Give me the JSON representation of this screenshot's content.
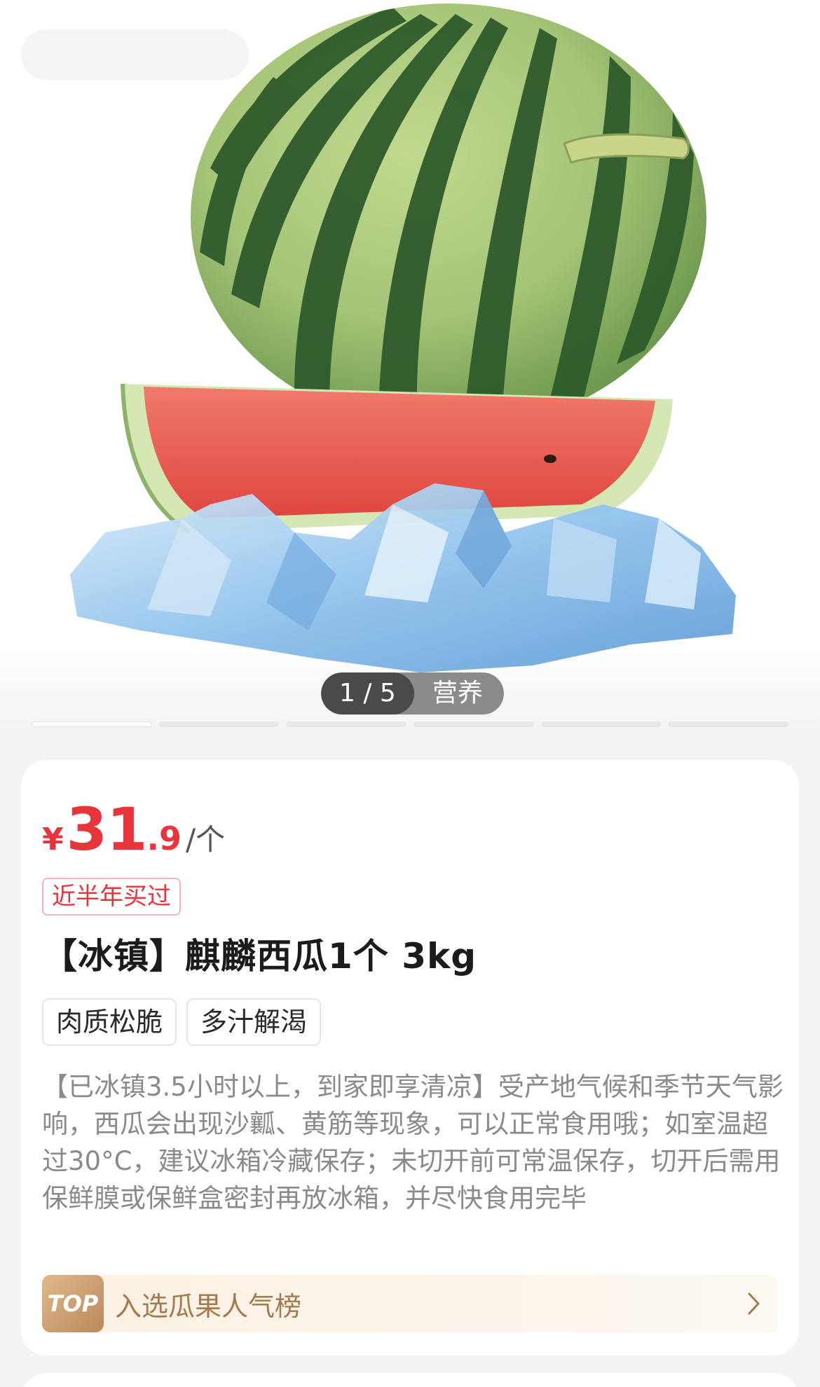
{
  "gallery": {
    "counter": "1 / 5",
    "tag": "营养",
    "total_slides": 6,
    "active_slide": 1
  },
  "product": {
    "price": {
      "currency": "¥",
      "integer": "31",
      "decimal": ".9",
      "unit": "/个"
    },
    "bought_badge": "近半年买过",
    "title": "【冰镇】麒麟西瓜1个 3kg",
    "tags": [
      "肉质松脆",
      "多汁解渴"
    ],
    "description": "【已冰镇3.5小时以上，到家即享清凉】受产地气候和季节天气影响，西瓜会出现沙瓤、黄筋等现象，可以正常食用哦；如室温超过30°C，建议冰箱冷藏保存；未切开前可常温保存，切开后需用保鲜膜或保鲜盒密封再放冰箱，并尽快食用完毕",
    "ranking": {
      "badge": "TOP",
      "label": "入选瓜果人气榜"
    }
  },
  "colors": {
    "price_red": "#e8343a",
    "rank_gold": "#a47a4e",
    "rind_dark": "#2f5a2c",
    "rind_light": "#a9c97a",
    "flesh_red": "#e9574f",
    "ice_blue": "#8fc3ee"
  },
  "icons": {
    "ranking_chevron": "chevron-right-icon"
  }
}
